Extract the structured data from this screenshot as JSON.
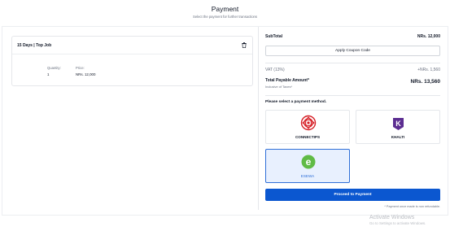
{
  "header": {
    "title": "Payment",
    "subtitle": "Select the payment for further transactions"
  },
  "job": {
    "title": "15 Days | Top Job",
    "quantity_label": "Quantity:",
    "quantity_value": "1",
    "price_label": "Price:",
    "price_value": "NRs. 12,000",
    "delete_icon": "trash-icon"
  },
  "summary": {
    "subtotal_label": "SubTotal",
    "subtotal_value": "NRs. 12,000",
    "coupon_button": "Apply Coupon Code",
    "vat_label": "VAT (13%)",
    "vat_value": "+NRs. 1,560",
    "total_label": "Total Payable Amount*",
    "total_value": "NRs. 13,560",
    "total_note": "Inclusive of Taxes*"
  },
  "payment": {
    "prompt": "Please select a payment method.",
    "options": [
      {
        "name": "CONNECTIPS",
        "icon": "connectips-logo",
        "color": "#d62027",
        "selected": false
      },
      {
        "name": "KHALTI",
        "icon": "khalti-logo",
        "color": "#5c2d91",
        "selected": false
      },
      {
        "name": "ESEWA",
        "icon": "esewa-logo",
        "color": "#60bb46",
        "selected": true
      }
    ],
    "proceed_button": "Proceed to Payment",
    "refund_note": "* Payment once made is non refundable."
  },
  "watermark": {
    "line1": "Activate Windows",
    "line2": "Go to Settings to activate Windows."
  },
  "colors": {
    "primary": "#0b57d0",
    "selected_border": "#2f6fd8",
    "selected_bg": "#e8f0fe"
  }
}
